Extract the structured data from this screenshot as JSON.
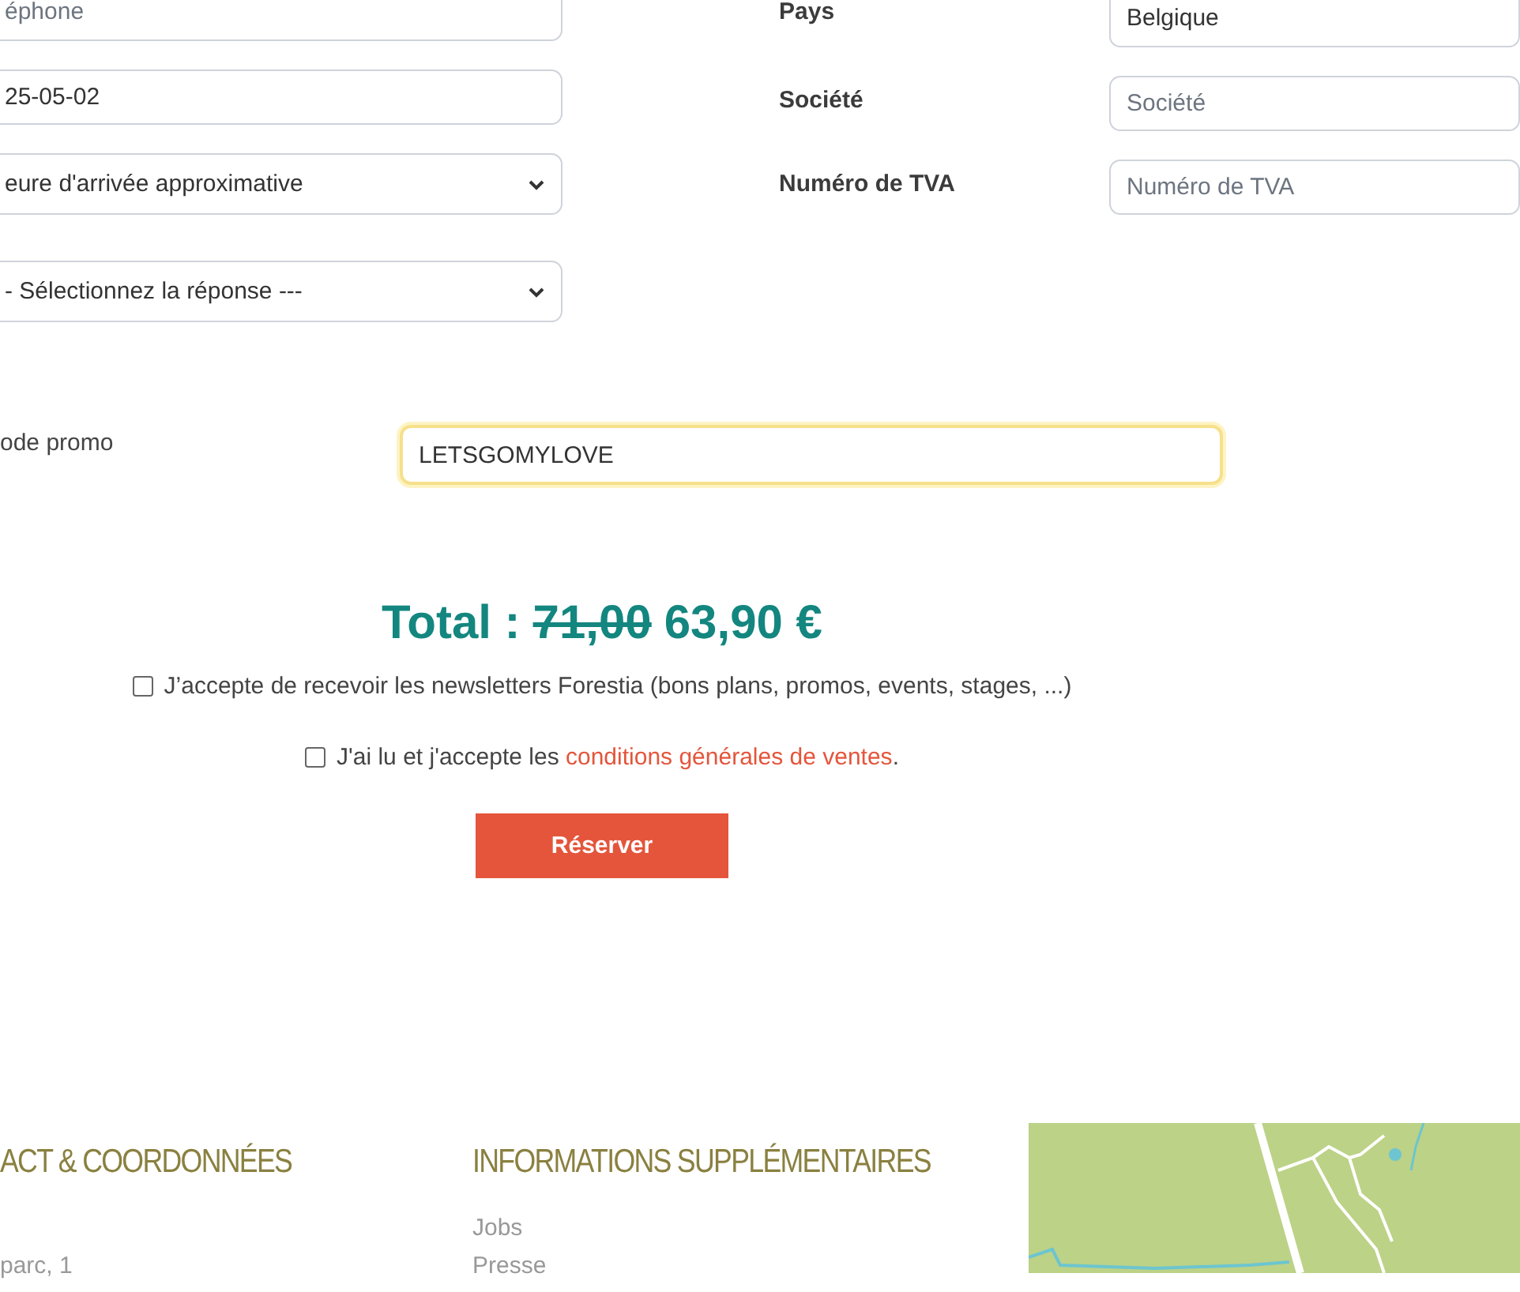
{
  "contact_fields": [
    {
      "kind": "input",
      "placeholder": "éphone"
    },
    {
      "kind": "input",
      "value": "25-05-02"
    },
    {
      "kind": "select",
      "value": "eure d'arrivée approximative"
    },
    {
      "kind": "select",
      "value": "- Sélectionnez la réponse ---"
    }
  ],
  "company_fields": [
    {
      "label": "Pays",
      "kind": "input",
      "value": "Belgique"
    },
    {
      "label": "Société",
      "kind": "input",
      "placeholder": "Société"
    },
    {
      "label": "Numéro de TVA",
      "kind": "input",
      "placeholder": "Numéro de TVA"
    }
  ],
  "promo": {
    "label": "ode promo",
    "value": "LETSGOMYLOVE",
    "focused": true
  },
  "total": {
    "label": "Total :",
    "old_price": "71,00",
    "price": "63,90 €"
  },
  "consents": [
    {
      "text": "J’accepte de recevoir les newsletters Forestia (bons plans, promos, events, stages, ...)",
      "checked": false
    },
    {
      "text": "J'ai lu et j'accepte les",
      "link": "conditions générales de ventes",
      "after": ".",
      "checked": false
    }
  ],
  "submit_button": "Réserver",
  "footer": {
    "columns": [
      {
        "heading": "ACT & COORDONNÉES",
        "lines": [
          "parc, 1"
        ]
      },
      {
        "heading": "INFORMATIONS SUPPLÉMENTAIRES",
        "links": [
          "Jobs",
          "Presse"
        ]
      }
    ]
  }
}
